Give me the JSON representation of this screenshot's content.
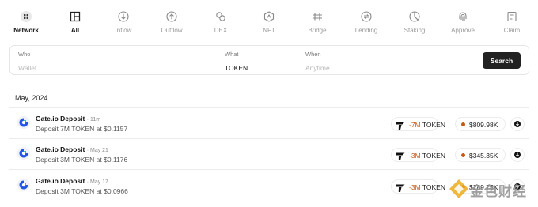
{
  "tabs": [
    {
      "label": "Network",
      "icon": "network-icon",
      "active": true
    },
    {
      "label": "All",
      "icon": "all-icon",
      "active": true
    },
    {
      "label": "Inflow",
      "icon": "inflow-icon",
      "active": false
    },
    {
      "label": "Outflow",
      "icon": "outflow-icon",
      "active": false
    },
    {
      "label": "DEX",
      "icon": "dex-icon",
      "active": false
    },
    {
      "label": "NFT",
      "icon": "nft-icon",
      "active": false
    },
    {
      "label": "Bridge",
      "icon": "bridge-icon",
      "active": false
    },
    {
      "label": "Lending",
      "icon": "lending-icon",
      "active": false
    },
    {
      "label": "Staking",
      "icon": "staking-icon",
      "active": false
    },
    {
      "label": "Approve",
      "icon": "approve-icon",
      "active": false
    },
    {
      "label": "Claim",
      "icon": "claim-icon",
      "active": false
    }
  ],
  "search": {
    "who_label": "Who",
    "who_placeholder": "Wallet",
    "what_label": "What",
    "what_value": "TOKEN",
    "when_label": "When",
    "when_placeholder": "Anytime",
    "button_label": "Search"
  },
  "section": {
    "month": "May, 2024"
  },
  "rows": [
    {
      "entity": "Gate.io Deposit",
      "time": "· 11m",
      "description": "Deposit 7M TOKEN at $0.1157",
      "amount": "-7M",
      "unit": "TOKEN",
      "usd": "$809.98K"
    },
    {
      "entity": "Gate.io Deposit",
      "time": "· May 21",
      "description": "Deposit 3M TOKEN at $0.1176",
      "amount": "-3M",
      "unit": "TOKEN",
      "usd": "$345.35K"
    },
    {
      "entity": "Gate.io Deposit",
      "time": "· May 17",
      "description": "Deposit 3M TOKEN at $0.0966",
      "amount": "-3M",
      "unit": "TOKEN",
      "usd": "$289.75K"
    }
  ],
  "colors": {
    "accent": "#c45a1a",
    "button": "#222222",
    "gate_blue": "#2354e6",
    "muted": "#9a9a9a"
  },
  "watermark": {
    "text": "金色财经"
  }
}
